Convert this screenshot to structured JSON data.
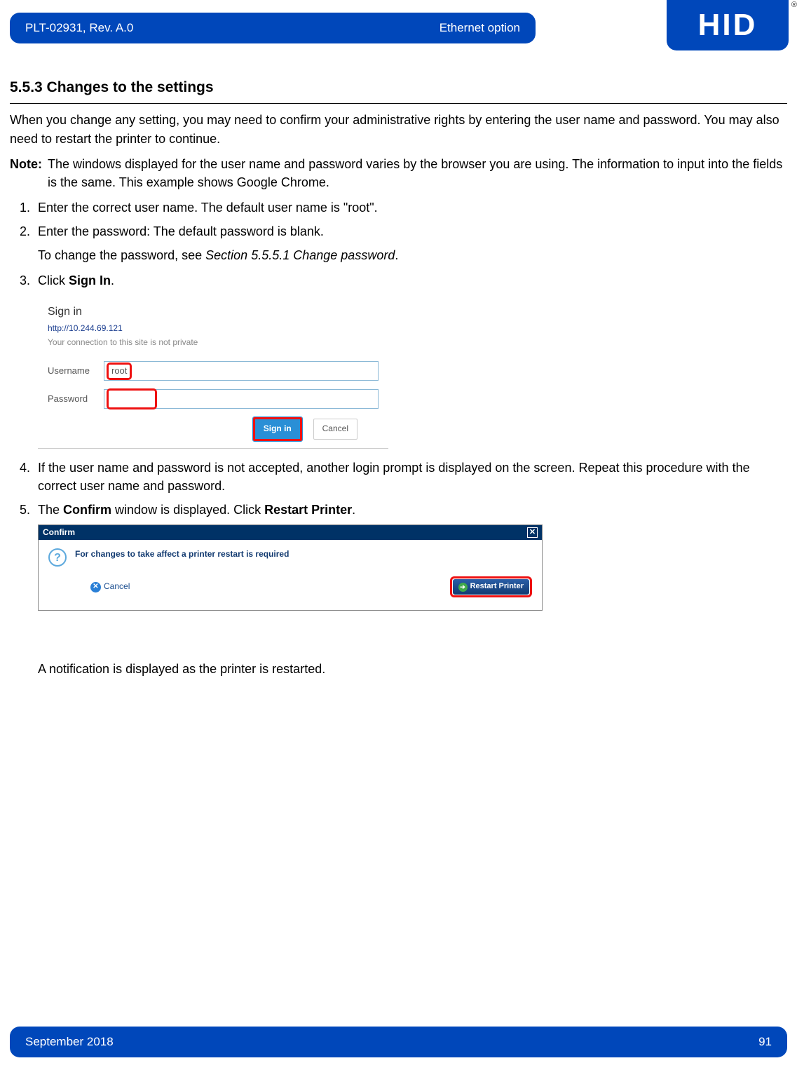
{
  "header": {
    "doc_id": "PLT-02931, Rev. A.0",
    "section": "Ethernet option",
    "logo": "HID",
    "reg": "®"
  },
  "heading": "5.5.3 Changes to the settings",
  "intro": "When you change any setting, you may need to confirm your administrative rights by entering the user name and password. You may also need to restart the printer to continue.",
  "note_label": "Note:",
  "note_text": "The windows displayed for the user name and password varies by the browser you are using. The information to input into the fields is the same. This example shows Google Chrome.",
  "step1": "Enter the correct user name. The default user name is \"root\".",
  "step2": "Enter the password: The default password is blank.",
  "step2_sub_a": "To change the password, see ",
  "step2_sub_b": "Section 5.5.5.1 Change password",
  "step2_sub_c": ".",
  "step3_a": "Click ",
  "step3_b": "Sign In",
  "step3_c": ".",
  "signin": {
    "title": "Sign in",
    "url": "http://10.244.69.121",
    "warn": "Your connection to this site is not private",
    "user_label": "Username",
    "user_value": "root",
    "pass_label": "Password",
    "signin_btn": "Sign in",
    "cancel_btn": "Cancel"
  },
  "step4": "If the user name and password is not accepted, another login prompt is displayed on the screen. Repeat this procedure with the correct user name and password.",
  "step5_a": "The ",
  "step5_b": "Confirm",
  "step5_c": " window is displayed. Click ",
  "step5_d": "Restart Printer",
  "step5_e": ".",
  "confirm": {
    "title": "Confirm",
    "msg": "For changes to take affect a printer restart is required",
    "cancel": "Cancel",
    "restart": "Restart Printer"
  },
  "after_confirm": "A notification is displayed as the printer is restarted.",
  "footer": {
    "date": "September 2018",
    "page": "91"
  }
}
